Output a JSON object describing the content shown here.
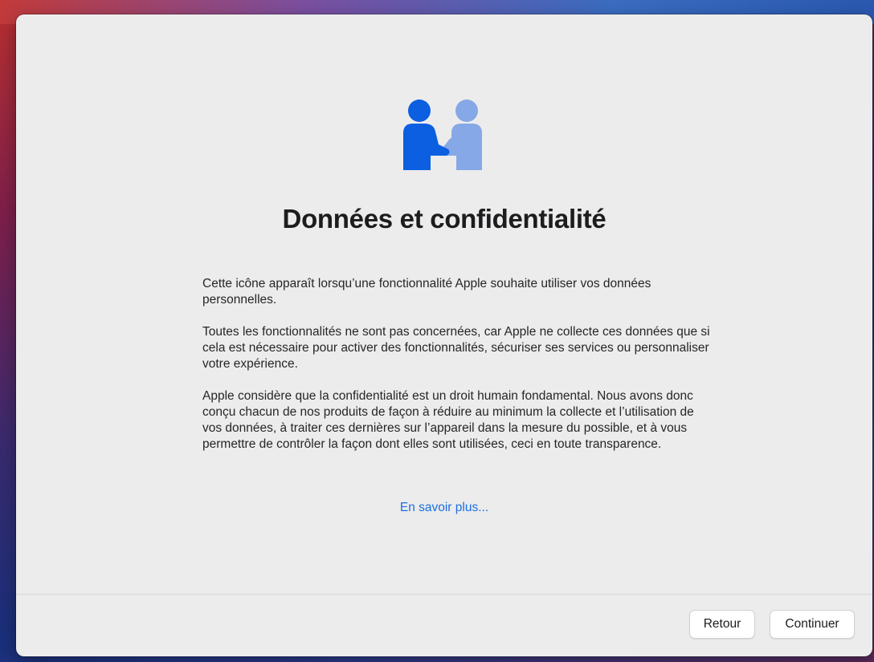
{
  "window": {
    "title": "Données et confidentialité"
  },
  "hero": {
    "icon": "data-privacy-handshake-icon",
    "colors": {
      "primary": "#0b5fe0",
      "secondary": "#86a8e6"
    }
  },
  "content": {
    "paragraphs": [
      "Cette icône apparaît lorsqu’une fonctionnalité Apple souhaite utiliser vos données personnelles.",
      "Toutes les fonctionnalités ne sont pas concernées, car Apple ne collecte ces données que si cela est nécessaire pour activer des fonctionnalités, sécuriser ses services ou personnaliser votre expérience.",
      "Apple considère que la confidentialité est un droit humain fondamental. Nous avons donc conçu chacun de nos produits de façon à réduire au minimum la collecte et l’utilisation de vos données, à traiter ces dernières sur l’appareil dans la mesure du possible, et à vous permettre de contrôler la façon dont elles sont utilisées, ceci en toute transparence."
    ],
    "learn_more": "En savoir plus..."
  },
  "footer": {
    "back_label": "Retour",
    "continue_label": "Continuer"
  },
  "colors": {
    "window_bg": "#ececec",
    "link": "#1a6fe0",
    "text": "#1d1d1f"
  }
}
